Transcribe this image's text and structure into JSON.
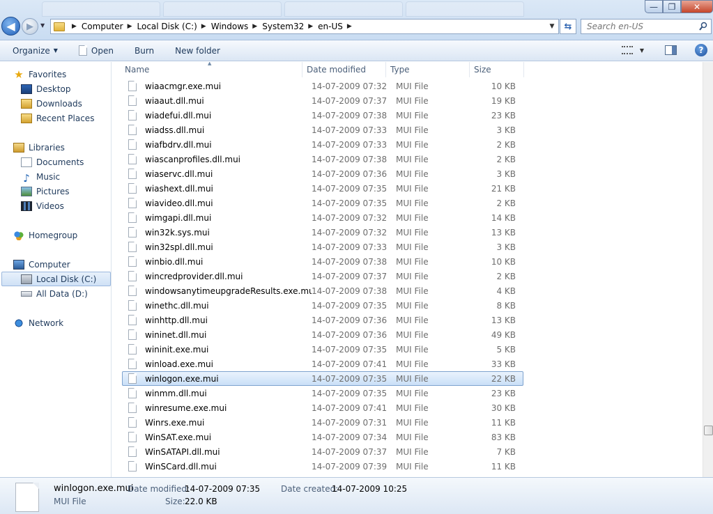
{
  "window": {
    "minimize": "—",
    "maximize": "❐",
    "close": "✕"
  },
  "address": {
    "crumbs": [
      "Computer",
      "Local Disk (C:)",
      "Windows",
      "System32",
      "en-US"
    ],
    "search_placeholder": "Search en-US"
  },
  "toolbar": {
    "organize": "Organize",
    "open": "Open",
    "burn": "Burn",
    "new_folder": "New folder"
  },
  "nav": {
    "favorites": "Favorites",
    "desktop": "Desktop",
    "downloads": "Downloads",
    "recent_places": "Recent Places",
    "libraries": "Libraries",
    "documents": "Documents",
    "music": "Music",
    "pictures": "Pictures",
    "videos": "Videos",
    "homegroup": "Homegroup",
    "computer": "Computer",
    "local_disk": "Local Disk (C:)",
    "all_data": "All Data (D:)",
    "network": "Network"
  },
  "columns": {
    "name": "Name",
    "date": "Date modified",
    "type": "Type",
    "size": "Size"
  },
  "files": [
    {
      "name": "wiaacmgr.exe.mui",
      "date": "14-07-2009 07:32",
      "type": "MUI File",
      "size": "10 KB"
    },
    {
      "name": "wiaaut.dll.mui",
      "date": "14-07-2009 07:37",
      "type": "MUI File",
      "size": "19 KB"
    },
    {
      "name": "wiadefui.dll.mui",
      "date": "14-07-2009 07:38",
      "type": "MUI File",
      "size": "23 KB"
    },
    {
      "name": "wiadss.dll.mui",
      "date": "14-07-2009 07:33",
      "type": "MUI File",
      "size": "3 KB"
    },
    {
      "name": "wiafbdrv.dll.mui",
      "date": "14-07-2009 07:33",
      "type": "MUI File",
      "size": "2 KB"
    },
    {
      "name": "wiascanprofiles.dll.mui",
      "date": "14-07-2009 07:38",
      "type": "MUI File",
      "size": "2 KB"
    },
    {
      "name": "wiaservc.dll.mui",
      "date": "14-07-2009 07:36",
      "type": "MUI File",
      "size": "3 KB"
    },
    {
      "name": "wiashext.dll.mui",
      "date": "14-07-2009 07:35",
      "type": "MUI File",
      "size": "21 KB"
    },
    {
      "name": "wiavideo.dll.mui",
      "date": "14-07-2009 07:35",
      "type": "MUI File",
      "size": "2 KB"
    },
    {
      "name": "wimgapi.dll.mui",
      "date": "14-07-2009 07:32",
      "type": "MUI File",
      "size": "14 KB"
    },
    {
      "name": "win32k.sys.mui",
      "date": "14-07-2009 07:32",
      "type": "MUI File",
      "size": "13 KB"
    },
    {
      "name": "win32spl.dll.mui",
      "date": "14-07-2009 07:33",
      "type": "MUI File",
      "size": "3 KB"
    },
    {
      "name": "winbio.dll.mui",
      "date": "14-07-2009 07:38",
      "type": "MUI File",
      "size": "10 KB"
    },
    {
      "name": "wincredprovider.dll.mui",
      "date": "14-07-2009 07:37",
      "type": "MUI File",
      "size": "2 KB"
    },
    {
      "name": "windowsanytimeupgradeResults.exe.mui",
      "date": "14-07-2009 07:38",
      "type": "MUI File",
      "size": "4 KB"
    },
    {
      "name": "winethc.dll.mui",
      "date": "14-07-2009 07:35",
      "type": "MUI File",
      "size": "8 KB"
    },
    {
      "name": "winhttp.dll.mui",
      "date": "14-07-2009 07:36",
      "type": "MUI File",
      "size": "13 KB"
    },
    {
      "name": "wininet.dll.mui",
      "date": "14-07-2009 07:36",
      "type": "MUI File",
      "size": "49 KB"
    },
    {
      "name": "wininit.exe.mui",
      "date": "14-07-2009 07:35",
      "type": "MUI File",
      "size": "5 KB"
    },
    {
      "name": "winload.exe.mui",
      "date": "14-07-2009 07:41",
      "type": "MUI File",
      "size": "33 KB"
    },
    {
      "name": "winlogon.exe.mui",
      "date": "14-07-2009 07:35",
      "type": "MUI File",
      "size": "22 KB",
      "selected": true
    },
    {
      "name": "winmm.dll.mui",
      "date": "14-07-2009 07:35",
      "type": "MUI File",
      "size": "23 KB"
    },
    {
      "name": "winresume.exe.mui",
      "date": "14-07-2009 07:41",
      "type": "MUI File",
      "size": "30 KB"
    },
    {
      "name": "Winrs.exe.mui",
      "date": "14-07-2009 07:31",
      "type": "MUI File",
      "size": "11 KB"
    },
    {
      "name": "WinSAT.exe.mui",
      "date": "14-07-2009 07:34",
      "type": "MUI File",
      "size": "83 KB"
    },
    {
      "name": "WinSATAPI.dll.mui",
      "date": "14-07-2009 07:37",
      "type": "MUI File",
      "size": "7 KB"
    },
    {
      "name": "WinSCard.dll.mui",
      "date": "14-07-2009 07:39",
      "type": "MUI File",
      "size": "11 KB"
    }
  ],
  "details": {
    "name": "winlogon.exe.mui",
    "type": "MUI File",
    "date_modified_label": "Date modified:",
    "date_modified": "14-07-2009 07:35",
    "date_created_label": "Date created:",
    "date_created": "14-07-2009 10:25",
    "size_label": "Size:",
    "size": "22.0 KB"
  }
}
